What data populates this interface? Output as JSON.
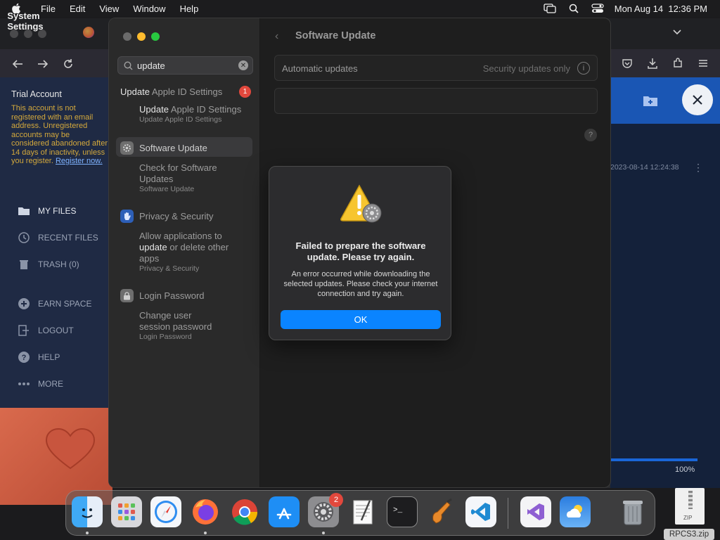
{
  "menubar": {
    "app_name": "System Settings",
    "menus": [
      "File",
      "Edit",
      "View",
      "Window",
      "Help"
    ],
    "clock": "Mon Aug 14  12:36 PM"
  },
  "browser_bg": {
    "account": {
      "title": "Trial Account",
      "warning": "This account is not registered with an email address. Unregistered accounts may be considered abandoned after 14 days of inactivity, unless you register.",
      "register_link": "Register now."
    },
    "nav": [
      {
        "label": "MY FILES",
        "icon": "folder-icon"
      },
      {
        "label": "RECENT FILES",
        "icon": "clock-icon"
      },
      {
        "label": "TRASH (0)",
        "icon": "trash-icon"
      },
      {
        "label": "EARN SPACE",
        "icon": "plus-circle-icon"
      },
      {
        "label": "LOGOUT",
        "icon": "logout-icon"
      },
      {
        "label": "HELP",
        "icon": "help-icon"
      },
      {
        "label": "MORE",
        "icon": "more-icon"
      }
    ],
    "file_date": "2023-08-14 12:24:38",
    "progress_label": "100%",
    "progress_value": 1.0
  },
  "settings": {
    "search": {
      "value": "update",
      "placeholder": "Search"
    },
    "results": [
      {
        "title_pre": "Update",
        "title_post": " Apple ID Settings",
        "badge": "1",
        "sub_pre": "Update",
        "sub_post": " Apple ID Settings",
        "caption": "Update Apple ID Settings"
      },
      {
        "title": "Software Update",
        "sub_lines": [
          "Check for Software",
          "Updates"
        ],
        "caption": "Software Update"
      },
      {
        "title": "Privacy & Security",
        "sub_lines": [
          "Allow applications to",
          "update or delete other",
          "apps"
        ],
        "caption": "Privacy & Security"
      },
      {
        "title": "Login Password",
        "sub_lines": [
          "Change user",
          "session password"
        ],
        "caption": "Login Password"
      }
    ],
    "pane_title": "Software Update",
    "automatic_updates": {
      "label": "Automatic updates",
      "value": "Security updates only"
    }
  },
  "alert": {
    "title": "Failed to prepare the software update. Please try again.",
    "message": "An error occurred while downloading the selected updates. Please check your internet connection and try again.",
    "ok_label": "OK"
  },
  "dock": {
    "apps": [
      "Finder",
      "Launchpad",
      "Safari",
      "Firefox",
      "Chrome",
      "App Store",
      "System Settings",
      "TextEdit",
      "Terminal",
      "GarageBand",
      "Visual Studio Code",
      "Visual Studio",
      "Weather",
      "Trash"
    ],
    "settings_badge": "2"
  },
  "desktop_file": {
    "name": "RPCS3.zip",
    "type_label": "ZIP"
  }
}
